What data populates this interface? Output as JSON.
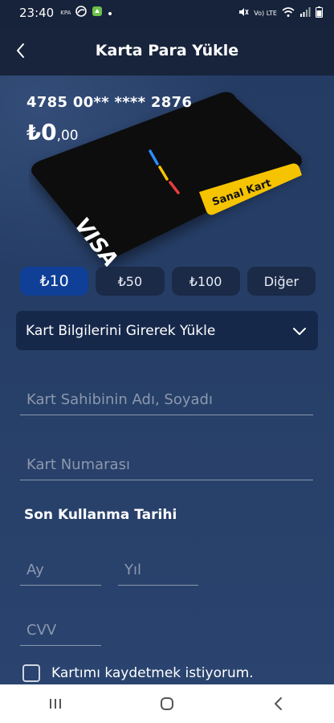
{
  "status_bar": {
    "time": "23:40",
    "carrier": "KPA",
    "network": "Vo) LTE"
  },
  "header": {
    "title": "Karta Para Yükle"
  },
  "card": {
    "number": "4785 00** **** 2876",
    "balance_currency": "₺",
    "balance_integer": "0",
    "balance_decimal": ",00",
    "badge_label": "Sanal Kart",
    "brand": "VISA",
    "colors": {
      "body": "#101010",
      "badge": "#f5c300",
      "stripe_blue": "#2b8cff",
      "stripe_yellow": "#f5c300",
      "stripe_red": "#e63c3c"
    }
  },
  "amounts": [
    {
      "label": "₺10",
      "selected": true
    },
    {
      "label": "₺50",
      "selected": false
    },
    {
      "label": "₺100",
      "selected": false
    },
    {
      "label": "Diğer",
      "selected": false
    }
  ],
  "dropdown": {
    "label": "Kart Bilgilerini Girerek Yükle"
  },
  "form": {
    "cardholder_placeholder": "Kart Sahibinin Adı, Soyadı",
    "card_number_placeholder": "Kart Numarası",
    "expiry_title": "Son Kullanma Tarihi",
    "month_placeholder": "Ay",
    "year_placeholder": "Yıl",
    "cvv_placeholder": "CVV",
    "save_card_label": "Kartımı kaydetmek istiyorum.",
    "save_card_checked": false
  },
  "colors": {
    "accent": "#0f3f96",
    "background": "#253c64",
    "header": "#18243c"
  }
}
